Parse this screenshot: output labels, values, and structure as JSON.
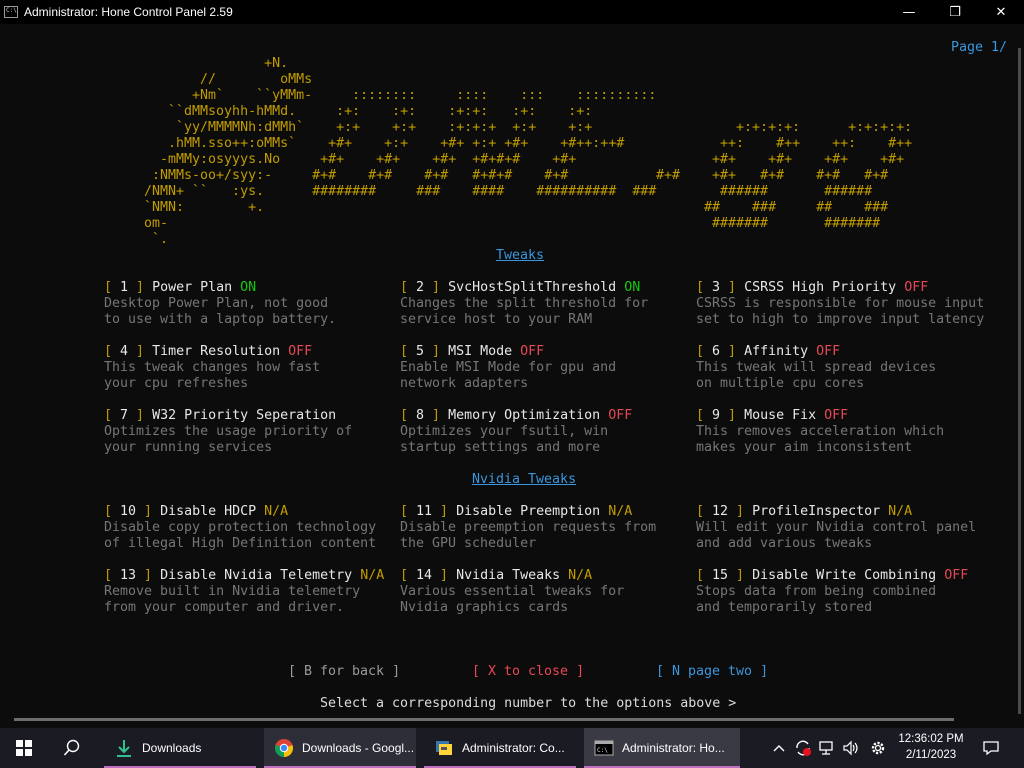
{
  "window": {
    "title": "Administrator:  Hone Control Panel 2.59",
    "min_glyph": "—",
    "max_glyph": "❐",
    "close_glyph": "✕"
  },
  "console": {
    "page_label": "Page 1/",
    "ascii_art": [
      "               +N.",
      "       //        oMMs",
      "      +Nm`    ``yMMm-     ::::::::     ::::    :::    ::::::::::",
      "   ``dMMsoyhh-hMMd.     :+:    :+:    :+:+:   :+:    :+:",
      "    `yy/MMMMNh:dMMh`    +:+    +:+    :+:+:+  +:+    +:+",
      "   .hMM.sso++:oMMs`    +#+    +:+    +#+ +:+ +#+    +#++:++#",
      "  -mMMy:osyyys.No     +#+    +#+    +#+  +#+#+#    +#+",
      " :NMMs-oo+/syy:-     #+#    #+#    #+#   #+#+#    #+#",
      "/NMN+ ``   :ys.      ########     ###    ####    ##########  ###",
      "`NMN:        +.",
      "om-",
      " `."
    ],
    "ascii_art_right": [
      "        +:+:+:+:      +:+:+:+:",
      "      ++:    #++    ++:    #++",
      "     +#+    +#+    +#+    +#+",
      "#+#    +#+   #+#    #+#   #+#",
      "      ######       ######",
      "    ##    ###     ##    ###",
      "     #######       #######"
    ],
    "tweaks_heading": "Tweaks",
    "nvidia_heading": "Nvidia Tweaks",
    "options": [
      {
        "num": "1",
        "name": "Power Plan",
        "status": "ON",
        "status_color": "#16c60c",
        "desc1": "Desktop Power Plan, not good",
        "desc2": "to use with a laptop battery."
      },
      {
        "num": "2",
        "name": "SvcHostSplitThreshold",
        "status": "ON",
        "status_color": "#16c60c",
        "desc1": "Changes the split threshold for",
        "desc2": "service host to your RAM"
      },
      {
        "num": "3",
        "name": "CSRSS High Priority",
        "status": "OFF",
        "status_color": "#e74856",
        "desc1": "CSRSS is responsible for mouse input",
        "desc2": "set to high to improve input latency"
      },
      {
        "num": "4",
        "name": "Timer Resolution",
        "status": "OFF",
        "status_color": "#e74856",
        "desc1": "This tweak changes how fast",
        "desc2": "your cpu refreshes"
      },
      {
        "num": "5",
        "name": "MSI Mode",
        "status": "OFF",
        "status_color": "#e74856",
        "desc1": "Enable MSI Mode for gpu and",
        "desc2": "network adapters"
      },
      {
        "num": "6",
        "name": "Affinity",
        "status": "OFF",
        "status_color": "#e74856",
        "desc1": "This tweak will spread devices",
        "desc2": "on multiple cpu cores"
      },
      {
        "num": "7",
        "name": "W32 Priority Seperation",
        "status": "",
        "status_color": "#e74856",
        "desc1": "Optimizes the usage priority of",
        "desc2": "your running services"
      },
      {
        "num": "8",
        "name": "Memory Optimization",
        "status": "OFF",
        "status_color": "#e74856",
        "desc1": "Optimizes your fsutil, win",
        "desc2": "startup settings and more"
      },
      {
        "num": "9",
        "name": "Mouse Fix",
        "status": "OFF",
        "status_color": "#e74856",
        "desc1": "This removes acceleration which",
        "desc2": "makes your aim inconsistent"
      },
      {
        "num": "10",
        "name": "Disable HDCP",
        "status": "N/A",
        "status_color": "#c19c00",
        "desc1": "Disable copy protection technology",
        "desc2": "of illegal High Definition content"
      },
      {
        "num": "11",
        "name": "Disable Preemption",
        "status": "N/A",
        "status_color": "#c19c00",
        "desc1": "Disable preemption requests from",
        "desc2": "the GPU scheduler"
      },
      {
        "num": "12",
        "name": "ProfileInspector",
        "status": "N/A",
        "status_color": "#c19c00",
        "desc1": "Will edit your Nvidia control panel",
        "desc2": "and add various tweaks"
      },
      {
        "num": "13",
        "name": "Disable Nvidia Telemetry",
        "status": "N/A",
        "status_color": "#c19c00",
        "desc1": "Remove built in Nvidia telemetry",
        "desc2": "from your computer and driver."
      },
      {
        "num": "14",
        "name": "Nvidia Tweaks",
        "status": "N/A",
        "status_color": "#c19c00",
        "desc1": "Various essential tweaks for",
        "desc2": "Nvidia graphics cards"
      },
      {
        "num": "15",
        "name": "Disable Write Combining",
        "status": "OFF",
        "status_color": "#e74856",
        "desc1": "Stops data from being combined",
        "desc2": "and temporarily stored"
      }
    ],
    "back_label": "[ B for back ]",
    "close_label": "[ X to close ]",
    "next_label": "[ N page two ]",
    "prompt": "Select a corresponding number to the options above >"
  },
  "taskbar": {
    "items": [
      {
        "label": "Downloads",
        "icon": "download-icon"
      },
      {
        "label": "Downloads - Googl...",
        "icon": "chrome-icon"
      },
      {
        "label": "Administrator:  Co...",
        "icon": "terminal-icon"
      },
      {
        "label": "Administrator:  Ho...",
        "icon": "cmd-icon"
      }
    ],
    "time": "12:36:02 PM",
    "date": "2/11/2023"
  }
}
